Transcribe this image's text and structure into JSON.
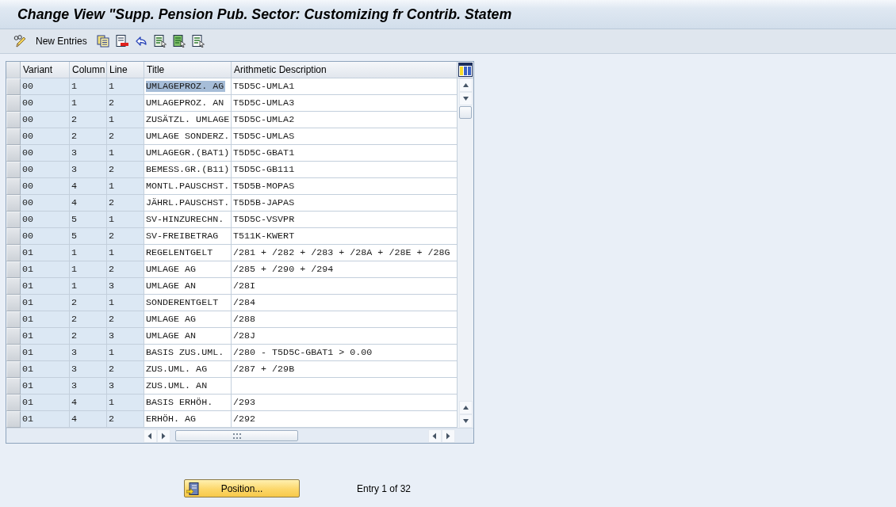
{
  "window": {
    "title": "Change View \"Supp. Pension Pub. Sector: Customizing fr Contrib. Statem"
  },
  "toolbar": {
    "new_entries": "New Entries"
  },
  "table": {
    "columns": [
      "Variant",
      "Column",
      "Line",
      "Title",
      "Arithmetic Description"
    ],
    "rows": [
      {
        "variant": "00",
        "column": "1",
        "line": "1",
        "title": "UMLAGEPROZ. AG",
        "description": "T5D5C-UMLA1",
        "selected": true
      },
      {
        "variant": "00",
        "column": "1",
        "line": "2",
        "title": "UMLAGEPROZ. AN",
        "description": "T5D5C-UMLA3",
        "selected": false
      },
      {
        "variant": "00",
        "column": "2",
        "line": "1",
        "title": "ZUSÄTZL. UMLAGE",
        "description": "T5D5C-UMLA2",
        "selected": false
      },
      {
        "variant": "00",
        "column": "2",
        "line": "2",
        "title": "UMLAGE SONDERZ.",
        "description": "T5D5C-UMLAS",
        "selected": false
      },
      {
        "variant": "00",
        "column": "3",
        "line": "1",
        "title": "UMLAGEGR.(BAT1)",
        "description": "T5D5C-GBAT1",
        "selected": false
      },
      {
        "variant": "00",
        "column": "3",
        "line": "2",
        "title": "BEMESS.GR.(B11)",
        "description": "T5D5C-GB111",
        "selected": false
      },
      {
        "variant": "00",
        "column": "4",
        "line": "1",
        "title": "MONTL.PAUSCHST.",
        "description": "T5D5B-MOPAS",
        "selected": false
      },
      {
        "variant": "00",
        "column": "4",
        "line": "2",
        "title": "JÄHRL.PAUSCHST.",
        "description": "T5D5B-JAPAS",
        "selected": false
      },
      {
        "variant": "00",
        "column": "5",
        "line": "1",
        "title": "SV-HINZURECHN.",
        "description": "T5D5C-VSVPR",
        "selected": false
      },
      {
        "variant": "00",
        "column": "5",
        "line": "2",
        "title": "SV-FREIBETRAG",
        "description": "T511K-KWERT",
        "selected": false
      },
      {
        "variant": "01",
        "column": "1",
        "line": "1",
        "title": "REGELENTGELT",
        "description": "/281 + /282 + /283 + /28A + /28E + /28G",
        "selected": false
      },
      {
        "variant": "01",
        "column": "1",
        "line": "2",
        "title": "UMLAGE AG",
        "description": "/285 + /290 + /294",
        "selected": false
      },
      {
        "variant": "01",
        "column": "1",
        "line": "3",
        "title": "UMLAGE AN",
        "description": "/28I",
        "selected": false
      },
      {
        "variant": "01",
        "column": "2",
        "line": "1",
        "title": "SONDERENTGELT",
        "description": "/284",
        "selected": false
      },
      {
        "variant": "01",
        "column": "2",
        "line": "2",
        "title": "UMLAGE AG",
        "description": "/288",
        "selected": false
      },
      {
        "variant": "01",
        "column": "2",
        "line": "3",
        "title": "UMLAGE AN",
        "description": "/28J",
        "selected": false
      },
      {
        "variant": "01",
        "column": "3",
        "line": "1",
        "title": "BASIS ZUS.UML.",
        "description": "/280 - T5D5C-GBAT1 > 0.00",
        "selected": false
      },
      {
        "variant": "01",
        "column": "3",
        "line": "2",
        "title": "ZUS.UML. AG",
        "description": "/287 + /29B",
        "selected": false
      },
      {
        "variant": "01",
        "column": "3",
        "line": "3",
        "title": "ZUS.UML. AN",
        "selected": false
      },
      {
        "variant": "01",
        "column": "4",
        "line": "1",
        "title": "BASIS ERHÖH.",
        "description": "/293",
        "selected": false
      },
      {
        "variant": "01",
        "column": "4",
        "line": "2",
        "title": "ERHÖH. AG",
        "description": "/292",
        "selected": false
      }
    ]
  },
  "footer": {
    "position_button": "Position...",
    "entry_info": "Entry 1 of 32"
  }
}
